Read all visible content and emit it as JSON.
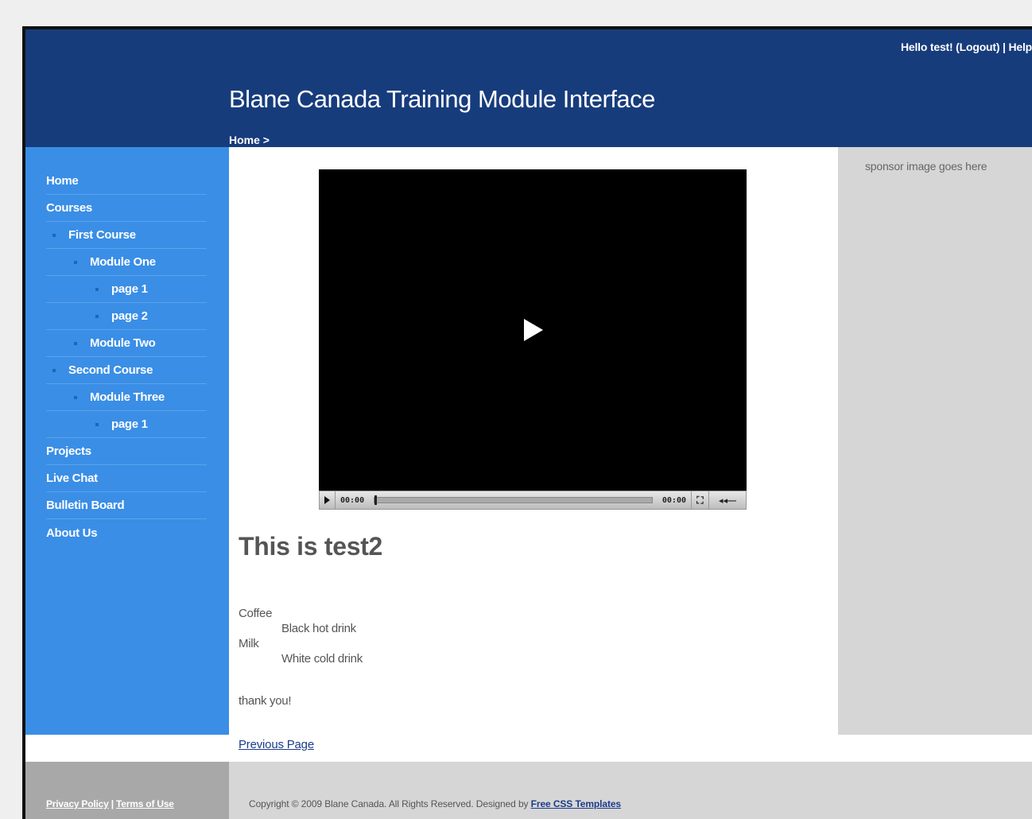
{
  "header": {
    "greeting": "Hello test!",
    "logout_label": "(Logout)",
    "separator": "|",
    "help_label": "Help",
    "site_title": "Blane Canada Training Module Interface",
    "breadcrumb": "Home >"
  },
  "sidebar": {
    "items": [
      {
        "label": "Home",
        "level": 0
      },
      {
        "label": "Courses",
        "level": 0
      },
      {
        "label": "First Course",
        "level": 1
      },
      {
        "label": "Module One",
        "level": 2
      },
      {
        "label": "page 1",
        "level": 3
      },
      {
        "label": "page 2",
        "level": 3
      },
      {
        "label": "Module Two",
        "level": 2
      },
      {
        "label": "Second Course",
        "level": 1
      },
      {
        "label": "Module Three",
        "level": 2
      },
      {
        "label": "page 1",
        "level": 3
      },
      {
        "label": "Projects",
        "level": 0
      },
      {
        "label": "Live Chat",
        "level": 0
      },
      {
        "label": "Bulletin Board",
        "level": 0
      },
      {
        "label": "About Us",
        "level": 0
      }
    ]
  },
  "video": {
    "time_current": "00:00",
    "time_total": "00:00",
    "progress": 0,
    "fullscreen_icon": "fullscreen-icon",
    "volume_icon": "volume-icon",
    "volume_glyph": "◂◂—"
  },
  "content": {
    "title": "This is test2",
    "definitions": [
      {
        "term": "Coffee",
        "desc": "Black hot drink"
      },
      {
        "term": "Milk",
        "desc": "White cold drink"
      }
    ],
    "thanks": "thank you!",
    "previous_link": "Previous Page"
  },
  "sponsor": {
    "text": "sponsor image goes here"
  },
  "footer": {
    "privacy_label": "Privacy Policy",
    "separator": "|",
    "terms_label": "Terms of Use",
    "copyright_text": "Copyright © 2009 Blane Canada. All Rights Reserved. Designed by",
    "templates_link": "Free CSS Templates"
  },
  "colors": {
    "header_bg": "#173c7c",
    "sidebar_bg": "#3a8ee6",
    "sponsor_bg": "#d6d6d6",
    "link": "#1c3c8a"
  }
}
